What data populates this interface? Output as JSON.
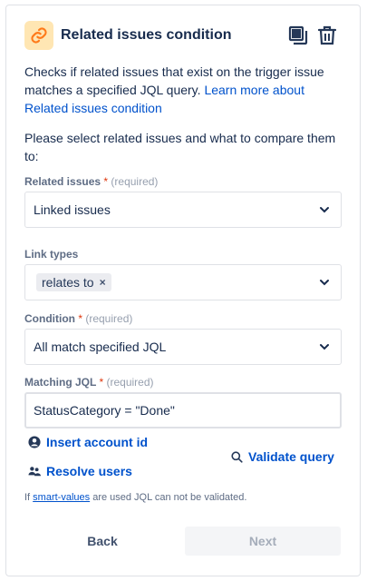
{
  "header": {
    "title": "Related issues condition",
    "icon": "link-icon",
    "accent": "#ffe6b3"
  },
  "description": {
    "text": "Checks if related issues that exist on the trigger issue matches a specified JQL query. ",
    "link": "Learn more about Related issues condition"
  },
  "prompt": "Please select related issues and what to compare them to:",
  "related_issues": {
    "label": "Related issues",
    "required_star": "*",
    "required": "(required)",
    "value": "Linked issues"
  },
  "link_types": {
    "label": "Link types",
    "tags": [
      "relates to"
    ],
    "remove_glyph": "×"
  },
  "condition": {
    "label": "Condition",
    "required_star": "*",
    "required": "(required)",
    "value": "All match specified JQL"
  },
  "matching_jql": {
    "label": "Matching JQL",
    "required_star": "*",
    "required": "(required)",
    "value": "StatusCategory = \"Done\""
  },
  "actions": {
    "insert_account": "Insert account id",
    "resolve_users": "Resolve users",
    "validate": "Validate query"
  },
  "footnote": {
    "prefix": "If ",
    "link": "smart-values",
    "suffix": " are used JQL can not be validated."
  },
  "buttons": {
    "back": "Back",
    "next": "Next"
  },
  "colors": {
    "link": "#0052cc",
    "required": "#de350b",
    "text": "#172b4d"
  }
}
